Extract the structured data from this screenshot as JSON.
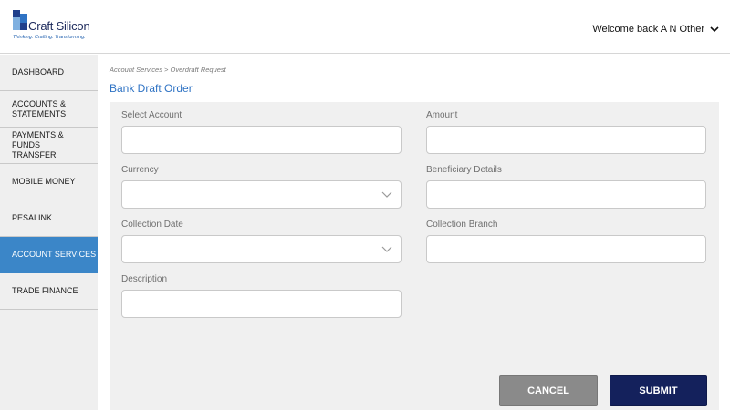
{
  "header": {
    "logo_name": "Craft Silicon",
    "logo_tagline": "Thinking. Crafting. Transforming.",
    "welcome_text": "Welcome back A N Other"
  },
  "sidebar": {
    "items": [
      {
        "label": "DASHBOARD"
      },
      {
        "label": "ACCOUNTS & STATEMENTS"
      },
      {
        "label": "PAYMENTS & FUNDS TRANSFER"
      },
      {
        "label": "MOBILE MONEY"
      },
      {
        "label": "PESALINK"
      },
      {
        "label": "ACCOUNT SERVICES"
      },
      {
        "label": "TRADE FINANCE"
      }
    ],
    "active_index": 5
  },
  "main": {
    "breadcrumb": "Account Services > Overdraft Request",
    "title": "Bank Draft Order",
    "form": {
      "select_account": {
        "label": "Select Account",
        "value": ""
      },
      "amount": {
        "label": "Amount",
        "value": ""
      },
      "currency": {
        "label": "Currency",
        "value": ""
      },
      "beneficiary_details": {
        "label": "Beneficiary Details",
        "value": ""
      },
      "collection_date": {
        "label": "Collection Date",
        "value": ""
      },
      "collection_branch": {
        "label": "Collection Branch",
        "value": ""
      },
      "description": {
        "label": "Description",
        "value": ""
      }
    },
    "buttons": {
      "cancel": "CANCEL",
      "submit": "SUBMIT"
    }
  },
  "colors": {
    "accent": "#3b86c8",
    "title_blue": "#2f73c4",
    "submit_navy": "#14215c",
    "cancel_gray": "#8a8a8a",
    "panel_bg": "#f0f0f0"
  },
  "icons": {
    "user_menu": "chevron-down-icon",
    "select": "chevron-down-icon"
  }
}
